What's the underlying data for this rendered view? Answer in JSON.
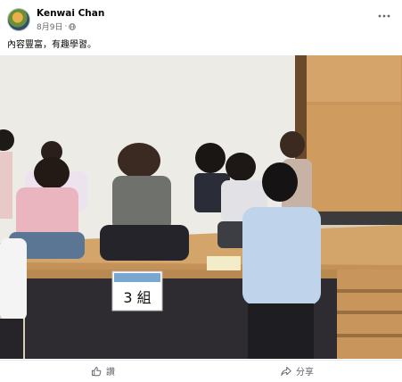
{
  "post": {
    "author": "Kenwai Chan",
    "date": "8月9日",
    "separator": "·",
    "caption": "內容豐富，有趣學習。",
    "more_icon": "more-horizontal-icon",
    "privacy_icon": "globe-icon"
  },
  "photo": {
    "sign_text": "3 組"
  },
  "actions": {
    "like_label": "讚",
    "share_label": "分享"
  },
  "colors": {
    "secondary_text": "#65676b",
    "primary_text": "#050505",
    "divider": "#e4e6eb"
  }
}
